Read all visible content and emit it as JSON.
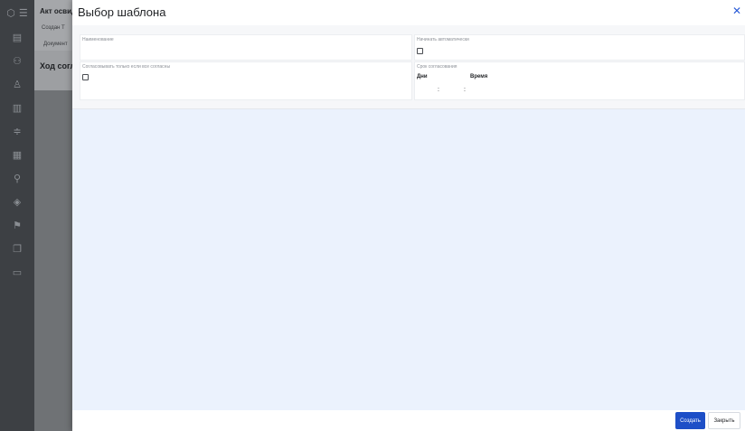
{
  "background": {
    "title": "Акт освид",
    "tabs": "Создан  Т",
    "tab_document": "Документ",
    "section_title": "Ход согл",
    "sidebar_icons": [
      "board-icon",
      "users-icon",
      "person-icon",
      "document-icon",
      "filter-icon",
      "list-icon",
      "tree-icon",
      "stack-icon",
      "flag-icon",
      "files-icon",
      "chart-icon"
    ]
  },
  "modal": {
    "title": "Выбор шаблона",
    "close_glyph": "✕",
    "fields": {
      "name_label": "Наименование",
      "auto_start_label": "Начинать автоматически",
      "approve_all_label": "Согласовывать только если все согласны",
      "deadline_label": "Срок согласования",
      "days_label": "Дни",
      "time_label": "Время",
      "colon1": ":",
      "colon2": ":"
    },
    "footer": {
      "create_label": "Создать",
      "close_label": "Закрыть"
    }
  }
}
